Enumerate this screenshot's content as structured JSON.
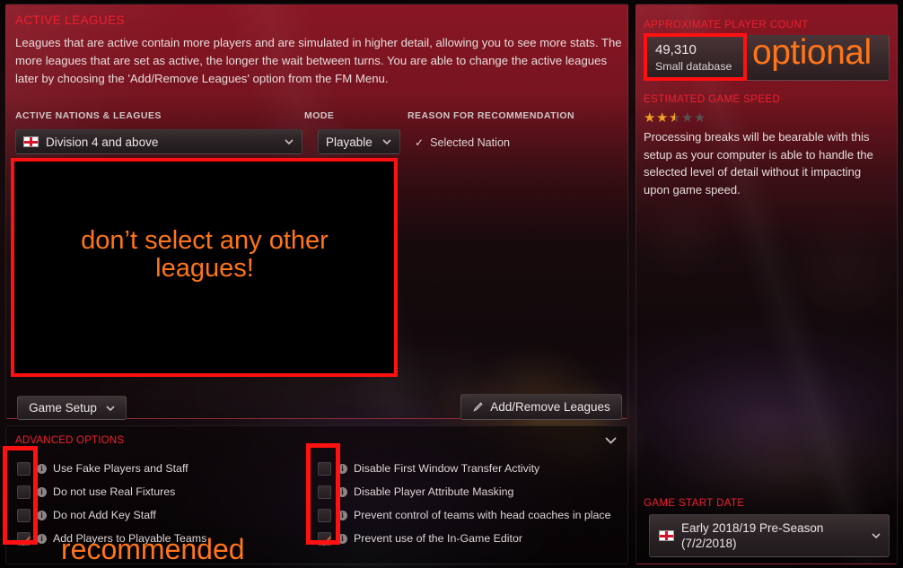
{
  "left_panel": {
    "title": "ACTIVE LEAGUES",
    "description": "Leagues that are active contain more players and are simulated in higher detail, allowing you to see more stats. The more leagues that are set as active, the longer the wait between turns. You are able to change the active leagues later by choosing the 'Add/Remove Leagues' option from the FM Menu.",
    "columns": {
      "nations_label": "ACTIVE NATIONS & LEAGUES",
      "mode_label": "MODE",
      "reason_label": "REASON FOR RECOMMENDATION"
    },
    "nation_row": {
      "flag": "england-flag-icon",
      "league": "Division 4 and above",
      "mode": "Playable",
      "reason": "Selected Nation",
      "reason_check": "✓"
    },
    "buttons": {
      "game_setup": "Game Setup",
      "add_remove_leagues": "Add/Remove Leagues",
      "add_remove_icon": "pencil-icon"
    }
  },
  "advanced": {
    "title": "ADVANCED OPTIONS",
    "collapse_icon": "chevron-down-icon",
    "left_options": [
      {
        "label": "Use Fake Players and Staff",
        "checked": false
      },
      {
        "label": "Do not use Real Fixtures",
        "checked": false
      },
      {
        "label": "Do not Add Key Staff",
        "checked": false
      },
      {
        "label": "Add Players to Playable Teams",
        "checked": true
      }
    ],
    "right_options": [
      {
        "label": "Disable First Window Transfer Activity",
        "checked": false
      },
      {
        "label": "Disable Player Attribute Masking",
        "checked": false
      },
      {
        "label": "Prevent control of teams with head coaches in place",
        "checked": false
      },
      {
        "label": "Prevent use of the In-Game Editor",
        "checked": true
      }
    ]
  },
  "right_panel": {
    "player_count_label": "APPROXIMATE PLAYER COUNT",
    "player_count_value": "49,310",
    "player_count_sub": "Small database",
    "game_speed_label": "ESTIMATED GAME SPEED",
    "game_speed_stars": 2.5,
    "game_speed_max": 5,
    "game_speed_text": "Processing breaks will be bearable with this setup as your computer is able to handle the selected level of detail without it impacting upon game speed.",
    "start_date_label": "GAME START DATE",
    "start_date_line1": "Early 2018/19 Pre-Season",
    "start_date_line2": "(7/2/2018)",
    "start_date_flag": "england-flag-icon"
  },
  "annotations": {
    "no_other_leagues": "don’t select any other\nleagues!",
    "recommended": "recommended",
    "optional": "optional"
  },
  "colors": {
    "annotation_red": "#ff1111",
    "annotation_orange": "#ff7518",
    "header_red": "#ee2030",
    "brand_maroon": "#92182 6",
    "star_gold": "#f0a024"
  }
}
